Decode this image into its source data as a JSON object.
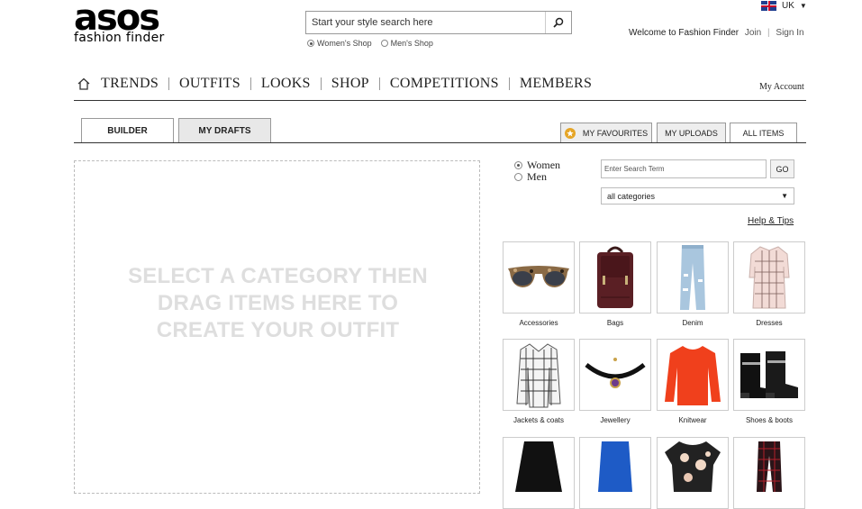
{
  "header": {
    "logo_main": "asos",
    "logo_sub": "fashion finder",
    "search": {
      "placeholder": "Start your style search here"
    },
    "shop_options": [
      {
        "label": "Women's Shop",
        "selected": true
      },
      {
        "label": "Men's Shop",
        "selected": false
      }
    ],
    "locale": "UK",
    "welcome": "Welcome to Fashion Finder",
    "join": "Join",
    "sign_in": "Sign In"
  },
  "nav": {
    "items": [
      "TRENDS",
      "OUTFITS",
      "LOOKS",
      "SHOP",
      "COMPETITIONS",
      "MEMBERS"
    ],
    "my_account": "My Account"
  },
  "tabs": {
    "builder": "BUILDER",
    "drafts": "MY DRAFTS",
    "favourites": "MY FAVOURITES",
    "uploads": "MY UPLOADS",
    "all_items": "ALL ITEMS"
  },
  "canvas": {
    "line1": "SELECT A CATEGORY THEN",
    "line2": "DRAG ITEMS HERE TO",
    "line3": "CREATE YOUR OUTFIT"
  },
  "filters": {
    "gender": [
      {
        "label": "Women",
        "selected": true
      },
      {
        "label": "Men",
        "selected": false
      }
    ],
    "term_placeholder": "Enter Search Term",
    "go": "GO",
    "category": "all categories",
    "help": "Help & Tips"
  },
  "categories": [
    "Accessories",
    "Bags",
    "Denim",
    "Dresses",
    "Jackets & coats",
    "Jewellery",
    "Knitwear",
    "Shoes & boots"
  ],
  "colors": {
    "accent_star": "#e5a526",
    "line": "#333333",
    "placeholder_text": "#dedede"
  }
}
